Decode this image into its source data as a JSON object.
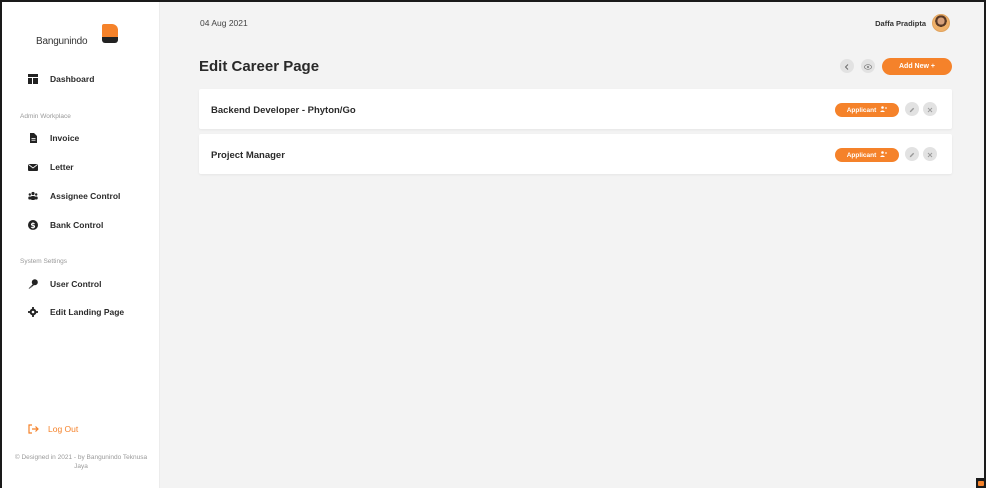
{
  "brand": {
    "name": "Bangunindo"
  },
  "sidebar": {
    "dashboard": {
      "label": "Dashboard",
      "icon": "dashboard-icon"
    },
    "admin_section": "Admin Workplace",
    "admin_items": [
      {
        "label": "Invoice",
        "icon": "invoice-icon"
      },
      {
        "label": "Letter",
        "icon": "envelope-icon"
      },
      {
        "label": "Assignee Control",
        "icon": "users-icon"
      },
      {
        "label": "Bank Control",
        "icon": "dollar-icon"
      }
    ],
    "system_section": "System Settings",
    "system_items": [
      {
        "label": "User Control",
        "icon": "key-icon"
      },
      {
        "label": "Edit Landing Page",
        "icon": "gear-icon"
      }
    ],
    "logout_label": "Log Out",
    "footer": "© Designed in 2021 - by Bangunindo Teknusa Jaya"
  },
  "header": {
    "date": "04 Aug 2021",
    "user_name": "Daffa Pradipta"
  },
  "page": {
    "title": "Edit Career Page",
    "add_new_label": "Add New +"
  },
  "careers": [
    {
      "title": "Backend Developer - Phyton/Go",
      "applicant_label": "Applicant"
    },
    {
      "title": "Project Manager",
      "applicant_label": "Applicant"
    }
  ],
  "colors": {
    "accent": "#f5822a",
    "background": "#f3f3f3",
    "card": "#ffffff"
  }
}
